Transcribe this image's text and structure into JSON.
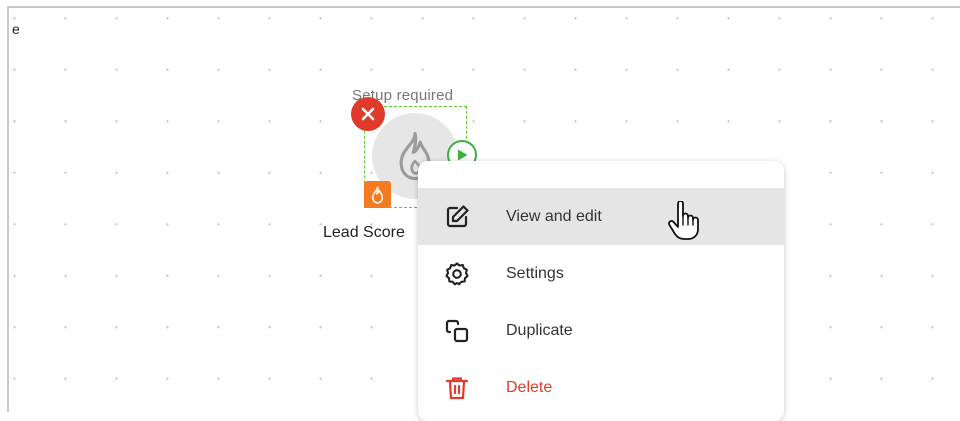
{
  "canvas": {
    "corner_text": "e"
  },
  "node": {
    "status_label": "Setup required",
    "title": "Lead Score",
    "icon": "flame-icon",
    "badge_icon": "flame-icon",
    "remove_icon": "close-icon",
    "run_icon": "play-icon"
  },
  "context_menu": {
    "items": [
      {
        "label": "View and edit",
        "icon": "edit-icon",
        "hover": true
      },
      {
        "label": "Settings",
        "icon": "gear-icon"
      },
      {
        "label": "Duplicate",
        "icon": "duplicate-icon"
      },
      {
        "label": "Delete",
        "icon": "trash-icon",
        "danger": true
      }
    ]
  },
  "colors": {
    "danger": "#e03b2a",
    "selection": "#5ccc2f",
    "run": "#3fae3f",
    "badge": "#f47b20",
    "hover": "#e5e5e5"
  }
}
